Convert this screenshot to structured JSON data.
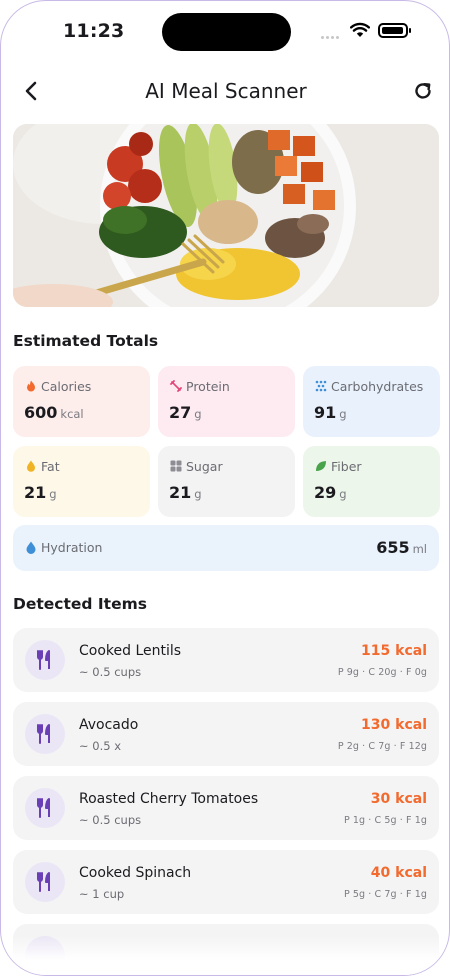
{
  "status_bar": {
    "time": "11:23"
  },
  "header": {
    "title": "AI Meal Scanner",
    "back_icon": "chevron-left-icon",
    "refresh_icon": "refresh-icon"
  },
  "estimated_totals": {
    "title": "Estimated Totals",
    "cards": [
      {
        "label": "Calories",
        "value": "600",
        "unit": "kcal",
        "icon": "flame-icon",
        "bg": "#fdeeec",
        "icon_color": "#f26a2e"
      },
      {
        "label": "Protein",
        "value": "27",
        "unit": "g",
        "icon": "dumbbell-icon",
        "bg": "#fdebf1",
        "icon_color": "#e2477a"
      },
      {
        "label": "Carbohydrates",
        "value": "91",
        "unit": "g",
        "icon": "grain-icon",
        "bg": "#e9f2fc",
        "icon_color": "#3f8fd6"
      },
      {
        "label": "Fat",
        "value": "21",
        "unit": "g",
        "icon": "droplet-icon",
        "bg": "#fdf8e8",
        "icon_color": "#f0b323"
      },
      {
        "label": "Sugar",
        "value": "21",
        "unit": "g",
        "icon": "sugar-cubes-icon",
        "bg": "#f3f3f4",
        "icon_color": "#8d8d93"
      },
      {
        "label": "Fiber",
        "value": "29",
        "unit": "g",
        "icon": "leaf-icon",
        "bg": "#ecf6ea",
        "icon_color": "#49a34a"
      }
    ],
    "hydration": {
      "label": "Hydration",
      "value": "655",
      "unit": "ml",
      "icon": "water-drop-icon",
      "icon_color": "#3f8fd6"
    }
  },
  "detected_items": {
    "title": "Detected Items",
    "items": [
      {
        "name": "Cooked Lentils",
        "qty": "~ 0.5  cups",
        "kcal": "115 kcal",
        "macros": "P 9g · C 20g · F 0g"
      },
      {
        "name": "Avocado",
        "qty": "~ 0.5 x",
        "kcal": "130 kcal",
        "macros": "P 2g · C 7g · F 12g"
      },
      {
        "name": "Roasted Cherry Tomatoes",
        "qty": "~ 0.5  cups",
        "kcal": "30 kcal",
        "macros": "P 1g · C 5g · F 1g"
      },
      {
        "name": "Cooked Spinach",
        "qty": "~ 1  cup",
        "kcal": "40 kcal",
        "macros": "P 5g · C 7g · F 1g"
      }
    ],
    "item_icon": "fork-knife-icon"
  },
  "colors": {
    "accent": "#f26a2e",
    "item_icon": "#6a3fb5"
  }
}
